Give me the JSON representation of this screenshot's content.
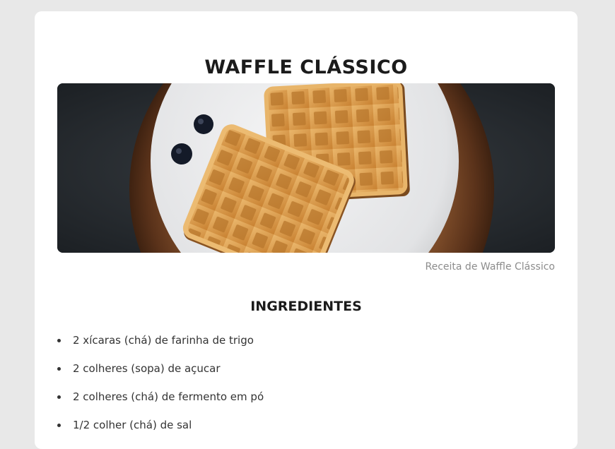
{
  "recipe": {
    "title": "WAFFLE CLÁSSICO",
    "image_caption": "Receita de Waffle Clássico"
  },
  "ingredients": {
    "heading": "INGREDIENTES",
    "items": [
      "2 xícaras (chá) de farinha de trigo",
      "2 colheres (sopa) de açucar",
      "2 colheres (chá) de fermento em pó",
      "1/2 colher (chá) de sal"
    ]
  },
  "colors": {
    "page_background": "#e8e8e8",
    "card_background": "#ffffff",
    "waffle": "#d99a4e",
    "plate": "#e9e9ea",
    "board": "#6b3f22"
  }
}
